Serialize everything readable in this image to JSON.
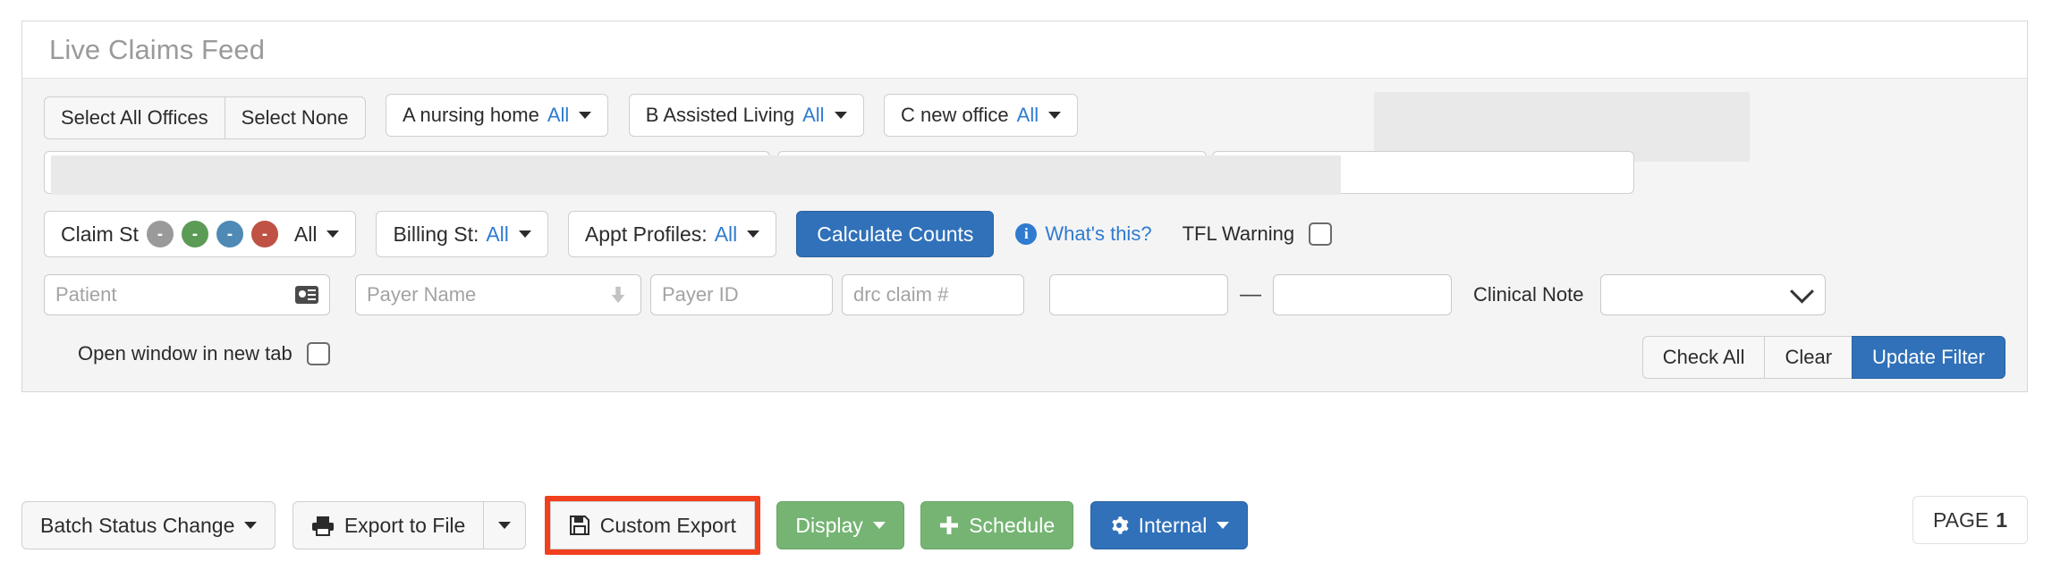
{
  "panel": {
    "title": "Live Claims Feed"
  },
  "offices": {
    "select_all_label": "Select All Offices",
    "select_none_label": "Select None",
    "items": [
      {
        "name": "A nursing home",
        "value": "All"
      },
      {
        "name": "B Assisted Living",
        "value": "All"
      },
      {
        "name": "C new office",
        "value": "All"
      }
    ]
  },
  "status_row": {
    "claim_status_label": "Claim St",
    "claim_status_dots": [
      {
        "name": "status-dot-gray",
        "color": "#9a9a9a",
        "glyph": "-"
      },
      {
        "name": "status-dot-green",
        "color": "#5b9b56",
        "glyph": "-"
      },
      {
        "name": "status-dot-blue",
        "color": "#4e8ab5",
        "glyph": "-"
      },
      {
        "name": "status-dot-red",
        "color": "#bf5145",
        "glyph": "-"
      }
    ],
    "claim_status_value": "All",
    "billing_status_label": "Billing St:",
    "billing_status_value": "All",
    "appt_profiles_label": "Appt Profiles:",
    "appt_profiles_value": "All",
    "calculate_counts_label": "Calculate Counts",
    "whats_this_label": "What's this?",
    "info_glyph": "i",
    "tfl_warning_label": "TFL Warning",
    "tfl_warning_checked": false
  },
  "inputs": {
    "patient_placeholder": "Patient",
    "patient_value": "",
    "payer_name_placeholder": "Payer Name",
    "payer_name_value": "",
    "payer_id_placeholder": "Payer ID",
    "payer_id_value": "",
    "drc_claim_placeholder": "drc claim #",
    "drc_claim_value": "",
    "date_from_value": "",
    "date_to_value": "",
    "range_separator": "—",
    "clinical_note_label": "Clinical Note",
    "clinical_note_value": ""
  },
  "actions": {
    "open_new_tab_label": "Open window in new tab",
    "open_new_tab_checked": false,
    "check_all_label": "Check All",
    "clear_label": "Clear",
    "update_filter_label": "Update Filter"
  },
  "toolbar": {
    "batch_status_change_label": "Batch Status Change",
    "export_to_file_label": "Export to File",
    "custom_export_label": "Custom Export",
    "display_label": "Display",
    "schedule_label": "Schedule",
    "internal_label": "Internal",
    "page_label": "PAGE",
    "page_number": "1",
    "highlight_color": "#f1401d"
  }
}
